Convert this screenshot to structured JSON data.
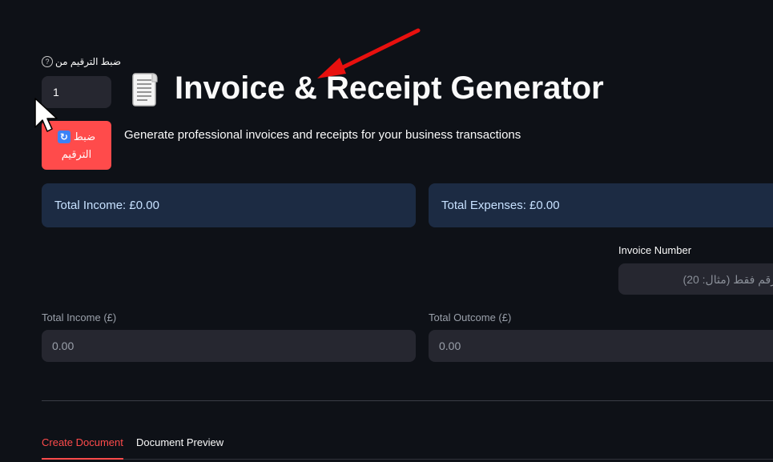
{
  "sidebar_control": {
    "label": "ضبط الترقيم من",
    "help_icon": "?",
    "value": "1",
    "reset_button": {
      "line1": "ضبط",
      "line2": "الترقيم",
      "icon": "refresh-icon"
    }
  },
  "header": {
    "icon": "receipt-icon",
    "title": "Invoice & Receipt Generator",
    "subtitle": "Generate professional invoices and receipts for your business transactions"
  },
  "totals": {
    "income": "Total Income: £0.00",
    "expenses": "Total Expenses: £0.00"
  },
  "invoice_number": {
    "label": "Invoice Number",
    "placeholder": "رقم فقط (مثال: 20)"
  },
  "fields": {
    "income_label": "Total Income (£)",
    "income_value": "0.00",
    "outcome_label": "Total Outcome (£)",
    "outcome_value": "0.00"
  },
  "tabs": [
    {
      "label": "Create Document",
      "active": true
    },
    {
      "label": "Document Preview",
      "active": false
    }
  ],
  "colors": {
    "background": "#0e1117",
    "accent": "#ff4b4b",
    "banner": "#1c2b43",
    "input": "#262730"
  }
}
